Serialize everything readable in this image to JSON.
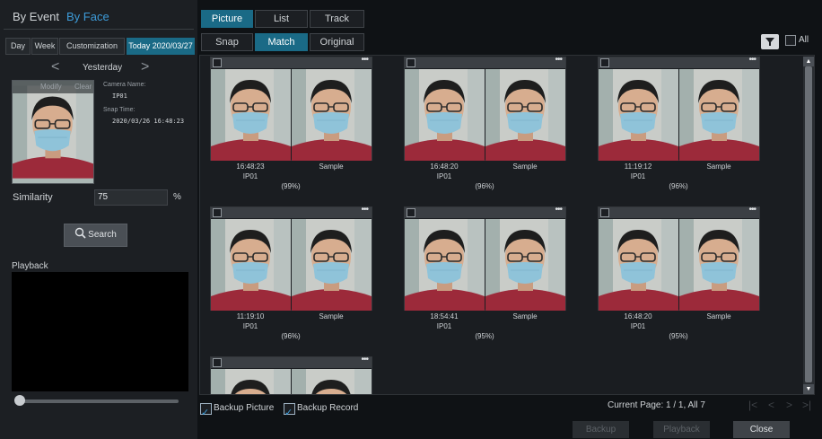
{
  "left_panel": {
    "tabs": [
      "By Event",
      "By Face"
    ],
    "date_buttons": [
      "Day",
      "Week",
      "Customization",
      "Today 2020/03/27"
    ],
    "date_nav_label": "Yesterday",
    "thumb_modify": "Modify",
    "thumb_clear": "Clear",
    "camera_name_label": "Camera Name:",
    "camera_name_value": "IP01",
    "snap_time_label": "Snap Time:",
    "snap_time_value": "2020/03/26 16:48:23",
    "similarity_label": "Similarity",
    "similarity_value": "75",
    "similarity_unit": "%",
    "search_label": "Search",
    "playback_label": "Playback"
  },
  "view_tabs": [
    "Picture",
    "List",
    "Track"
  ],
  "sub_tabs": [
    "Snap",
    "Match",
    "Original"
  ],
  "all_label": "All",
  "results": [
    {
      "time": "16:48:23",
      "camera": "IP01",
      "label": "Sample",
      "similarity": "(99%)"
    },
    {
      "time": "16:48:20",
      "camera": "IP01",
      "label": "Sample",
      "similarity": "(96%)"
    },
    {
      "time": "11:19:12",
      "camera": "IP01",
      "label": "Sample",
      "similarity": "(96%)"
    },
    {
      "time": "11:19:10",
      "camera": "IP01",
      "label": "Sample",
      "similarity": "(96%)"
    },
    {
      "time": "18:54:41",
      "camera": "IP01",
      "label": "Sample",
      "similarity": "(95%)"
    },
    {
      "time": "16:48:20",
      "camera": "IP01",
      "label": "Sample",
      "similarity": "(95%)"
    },
    {
      "time": "",
      "camera": "",
      "label": "",
      "similarity": ""
    }
  ],
  "bottom": {
    "backup_picture": "Backup Picture",
    "backup_record": "Backup Record",
    "current_page": "Current Page: 1 / 1, All 7",
    "backup_btn": "Backup",
    "playback_btn": "Playback",
    "close_btn": "Close"
  },
  "colors": {
    "accent_active": "#1a6a86",
    "tab_active_text": "#3d9bd8",
    "background": "#0f1215",
    "panel": "#1c1f23"
  },
  "icons": {
    "prev": "chevron-left-icon",
    "next": "chevron-right-icon",
    "search": "search-icon",
    "filter": "filter-icon",
    "more": "more-dots-icon"
  }
}
